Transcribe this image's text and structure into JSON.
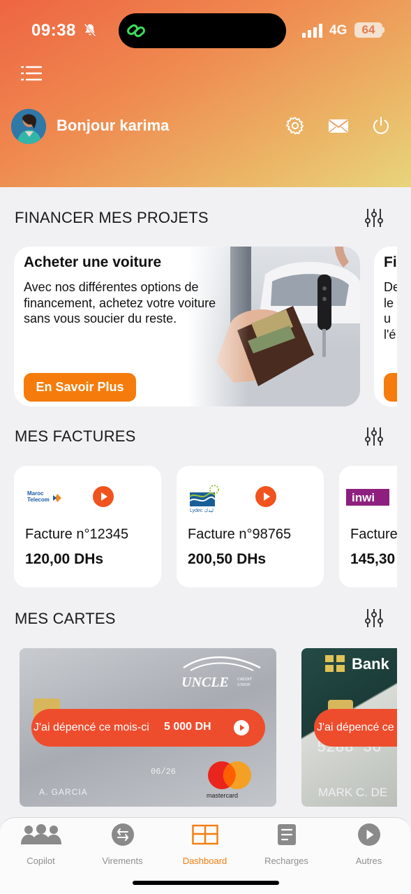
{
  "status_bar": {
    "time": "09:38",
    "network": "4G",
    "battery": "64"
  },
  "header": {
    "greeting": "Bonjour karima"
  },
  "sections": {
    "projects": "FINANCER MES PROJETS",
    "invoices": "MES FACTURES",
    "cards": "MES CARTES"
  },
  "projects": [
    {
      "title": "Acheter une voiture",
      "description": "Avec nos différentes options de financement, achetez votre voiture sans vous soucier du reste.",
      "button": "En Savoir Plus"
    },
    {
      "title": "Fi",
      "description": "De le su l'é",
      "button": ""
    }
  ],
  "invoices": [
    {
      "provider": "Maroc Telecom",
      "number": "Facture n°12345",
      "amount": "120,00 DHs"
    },
    {
      "provider": "Lydec",
      "number": "Facture n°98765",
      "amount": "200,50 DHs"
    },
    {
      "provider": "inwi",
      "number": "Facture",
      "amount": "145,30"
    }
  ],
  "cards": [
    {
      "bank": "UNCLE",
      "bank_sub": "CREDIT UNION",
      "number_hint": "06/26",
      "holder": "A. GARCIA",
      "brand": "mastercard",
      "spent_label": "J'ai dépencé ce mois-ci",
      "spent_amount": "5 000 DH"
    },
    {
      "bank": "Bank",
      "number_hint": "5288 36",
      "holder": "MARK C. DE",
      "spent_label": "J'ai dépencé ce"
    }
  ],
  "nav": [
    {
      "label": "Copilot",
      "icon": "people-icon",
      "active": false
    },
    {
      "label": "Virements",
      "icon": "transfer-icon",
      "active": false
    },
    {
      "label": "Dashboard",
      "icon": "dashboard-icon",
      "active": true
    },
    {
      "label": "Recharges",
      "icon": "recharge-icon",
      "active": false
    },
    {
      "label": "Autres",
      "icon": "play-icon",
      "active": false
    }
  ],
  "colors": {
    "accent": "#f57c0c",
    "pill": "#ee4d2d",
    "header_start": "#ee6542",
    "header_end": "#e8d47c"
  }
}
